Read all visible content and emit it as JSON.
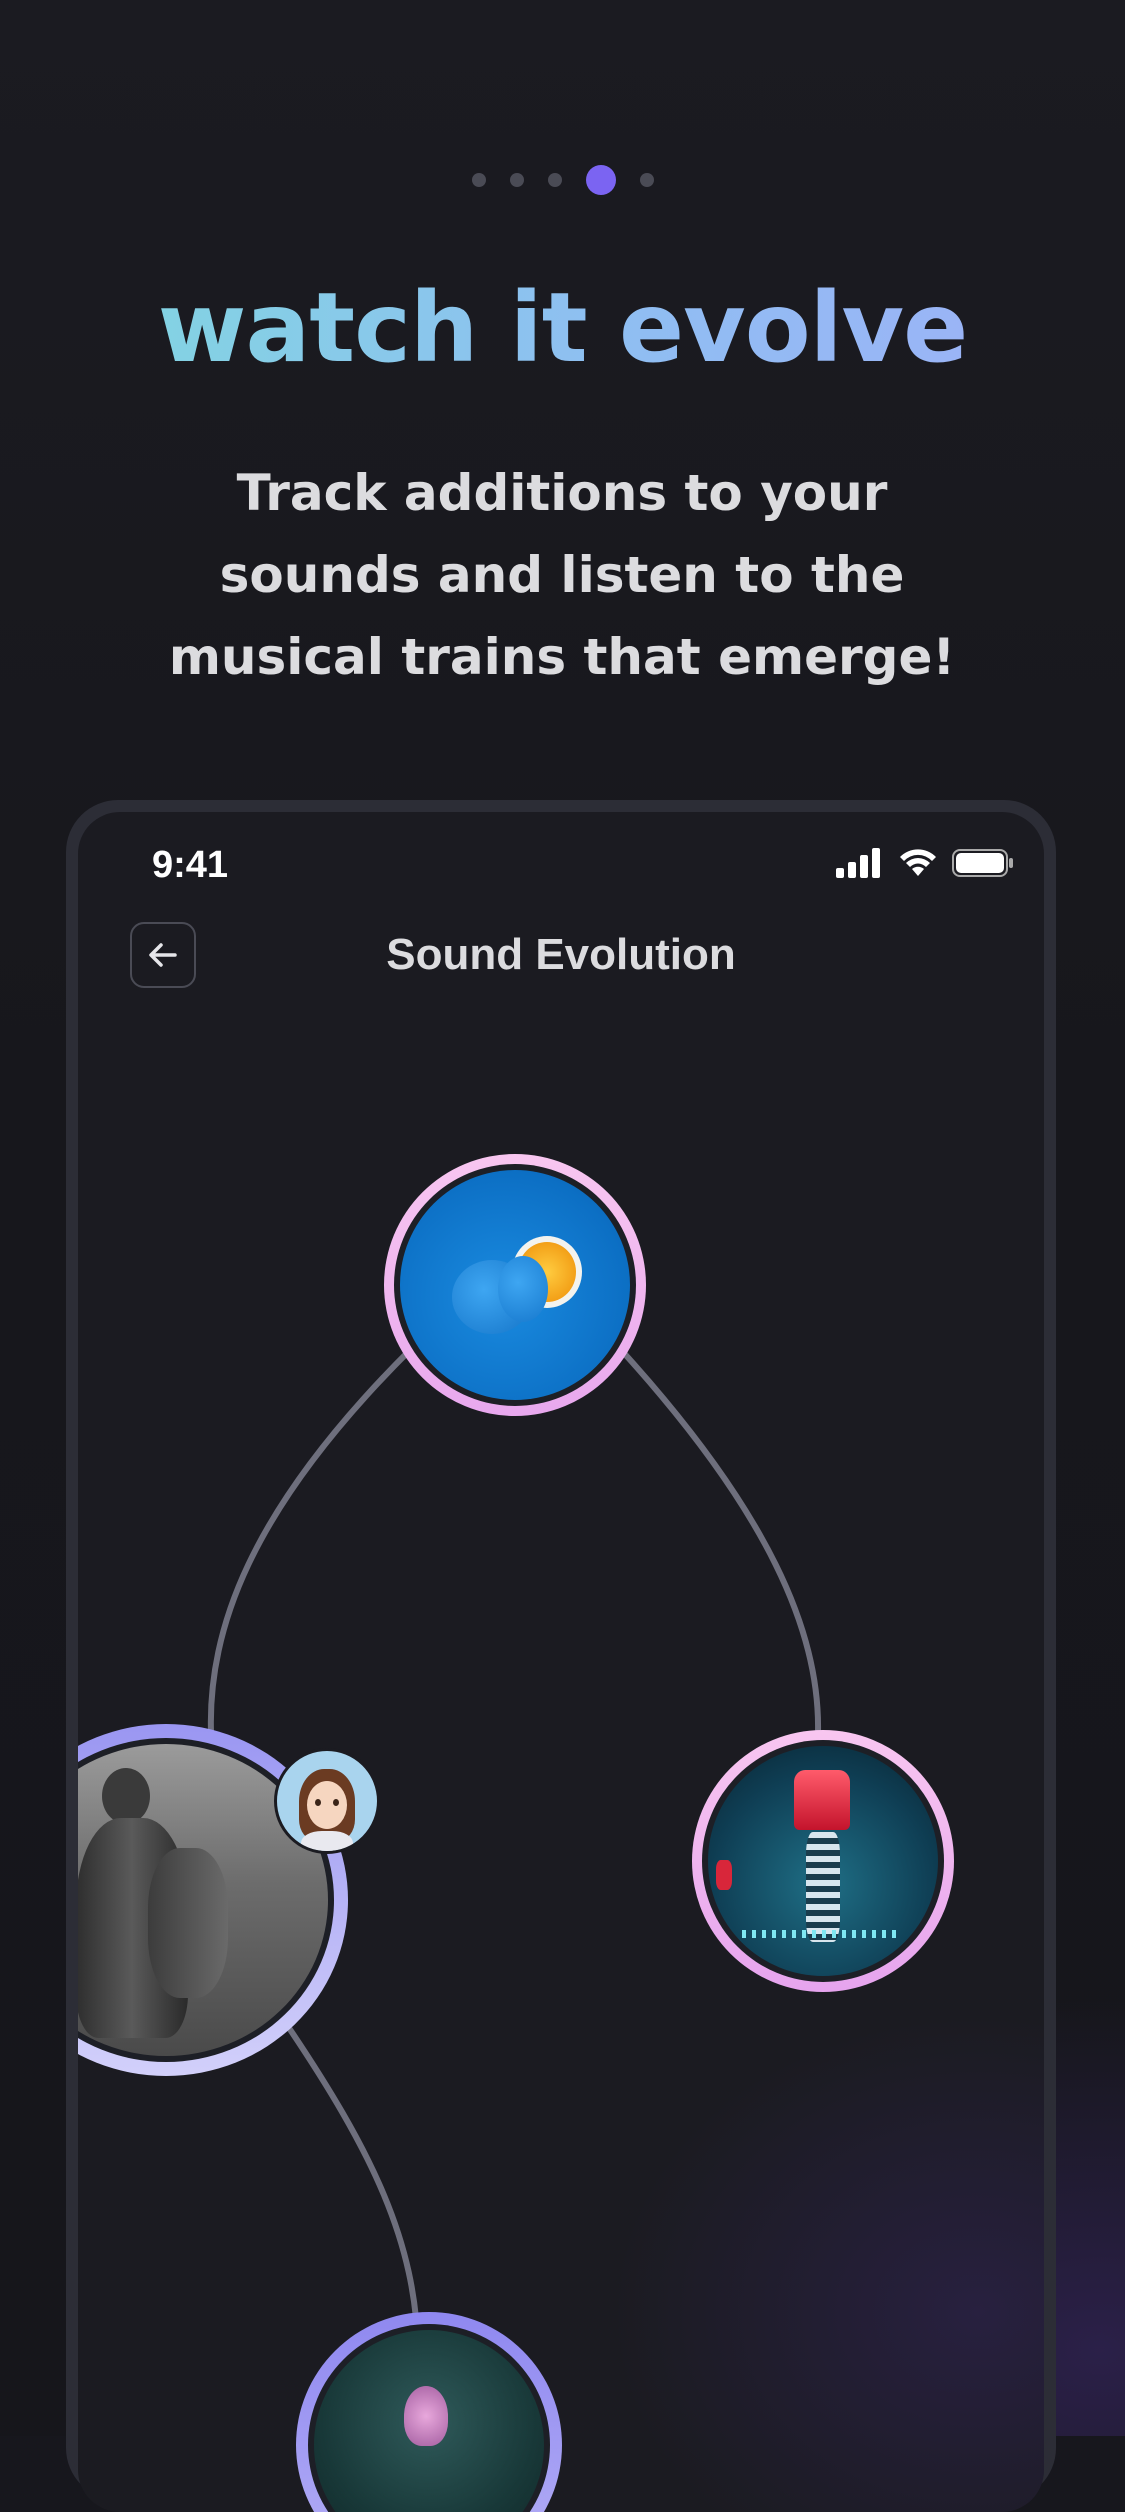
{
  "onboarding": {
    "page_indicator": {
      "count": 5,
      "active_index": 3
    },
    "headline": "watch it evolve",
    "subtitle": "Track additions to your sounds and listen to the musical trains that emerge!"
  },
  "phone": {
    "status_bar": {
      "time": "9:41",
      "icons": [
        "cellular-signal-icon",
        "wifi-icon",
        "battery-icon"
      ]
    },
    "nav": {
      "title": "Sound Evolution",
      "back_icon": "arrow-left-icon"
    },
    "sound_tree": {
      "nodes": [
        {
          "name": "root-sound",
          "artwork": "blue-orange-artwork",
          "ring": "pink"
        },
        {
          "name": "statue-sound",
          "artwork": "statue-artwork",
          "ring": "lavender",
          "contributor": "woman-memoji-avatar"
        },
        {
          "name": "neon-sound",
          "artwork": "neon-skeleton-artwork",
          "ring": "pink"
        },
        {
          "name": "flower-sound",
          "artwork": "flower-artwork",
          "ring": "violet"
        }
      ]
    }
  },
  "colors": {
    "background": "#17171d",
    "accent": "#7b64f2",
    "headline_gradient_start": "#7fd9de",
    "headline_gradient_end": "#9fb0f8",
    "ring_pink": "#f2b8f0",
    "ring_lavender": "#a7a4f4",
    "connector": "#6e6f7d"
  }
}
